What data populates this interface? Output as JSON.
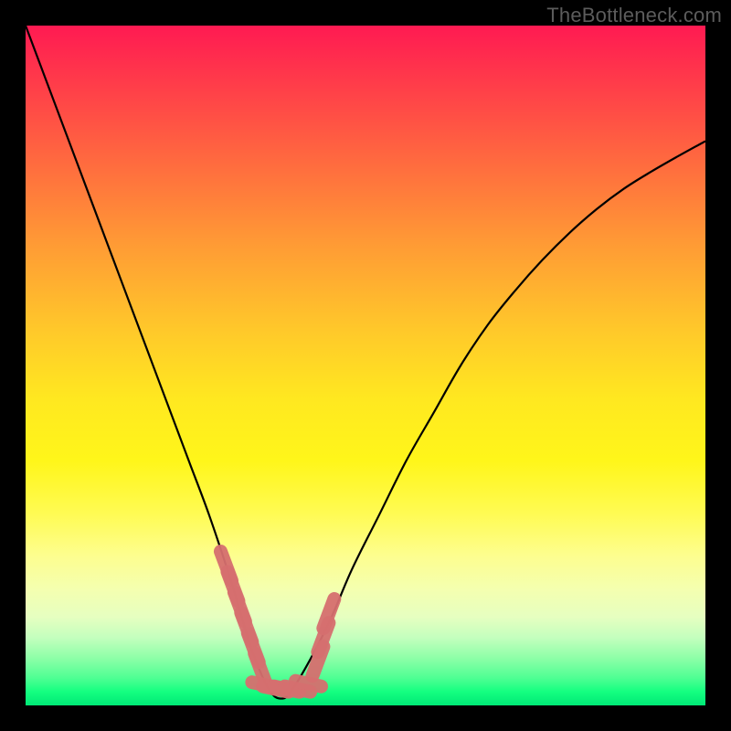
{
  "watermark": "TheBottleneck.com",
  "colors": {
    "background": "#000000",
    "curve": "#000000",
    "marker_fill": "#d66f6f",
    "marker_alt": "#e08a8a"
  },
  "chart_data": {
    "type": "line",
    "title": "",
    "xlabel": "",
    "ylabel": "",
    "xlim": [
      0,
      100
    ],
    "ylim": [
      0,
      100
    ],
    "x": [
      0,
      3,
      6,
      9,
      12,
      15,
      18,
      21,
      24,
      27,
      30,
      31.5,
      33,
      34.5,
      36,
      37.5,
      39,
      42,
      45,
      48,
      52,
      56,
      60,
      64,
      68,
      72,
      76,
      80,
      84,
      88,
      92,
      96,
      100
    ],
    "y": [
      100,
      92,
      84,
      76,
      68,
      60,
      52,
      44,
      36,
      28,
      19,
      14,
      9,
      5,
      2,
      1,
      2,
      7,
      13,
      20,
      28,
      36,
      43,
      50,
      56,
      61,
      65.5,
      69.5,
      73,
      76,
      78.5,
      80.8,
      83
    ],
    "minimum_x": 37,
    "markers": {
      "x": [
        29.5,
        30.5,
        31.5,
        32.5,
        33.5,
        34.5,
        35.2,
        36.8,
        38.4,
        40.0,
        41.6,
        43.0,
        43.8,
        44.6
      ],
      "y": [
        20.5,
        17.5,
        14.5,
        11.5,
        8.5,
        5.5,
        3.0,
        2.4,
        2.4,
        2.4,
        3.2,
        6.5,
        10.0,
        13.5
      ]
    }
  }
}
